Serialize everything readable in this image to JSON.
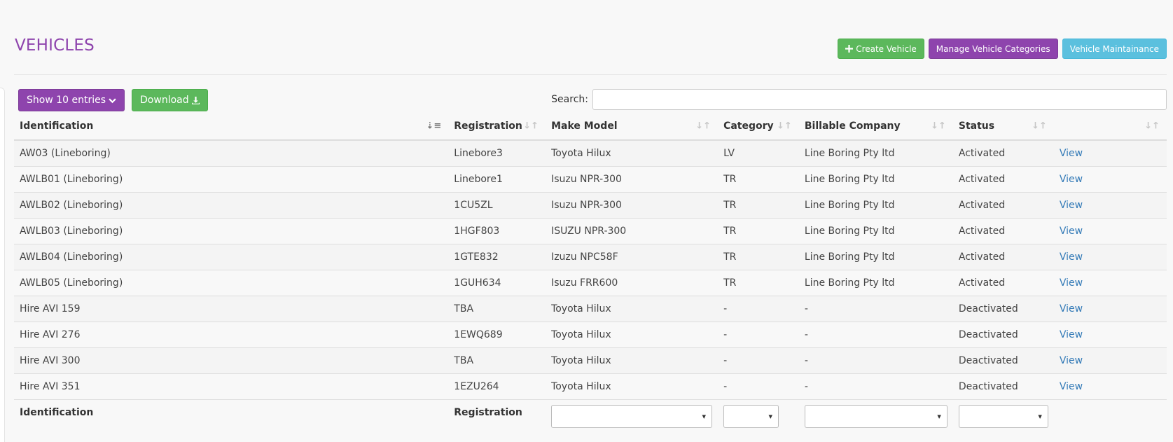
{
  "page": {
    "title": "VEHICLES"
  },
  "actions": {
    "create_label": "Create Vehicle",
    "manage_label": "Manage Vehicle Categories",
    "maintenance_label": "Vehicle Maintainance"
  },
  "toolbar": {
    "show_label": "Show 10 entries",
    "download_label": "Download",
    "search_label": "Search:",
    "search_value": ""
  },
  "table": {
    "headers": [
      "Identification",
      "Registration",
      "Make Model",
      "Category",
      "Billable Company",
      "Status",
      ""
    ],
    "rows": [
      [
        "AW03 (Lineboring)",
        "Linebore3",
        "Toyota Hilux",
        "LV",
        "Line Boring Pty ltd",
        "Activated",
        "View"
      ],
      [
        "AWLB01 (Lineboring)",
        "Linebore1",
        "Isuzu NPR-300",
        "TR",
        "Line Boring Pty ltd",
        "Activated",
        "View"
      ],
      [
        "AWLB02 (Lineboring)",
        "1CU5ZL",
        "Isuzu NPR-300",
        "TR",
        "Line Boring Pty ltd",
        "Activated",
        "View"
      ],
      [
        "AWLB03 (Lineboring)",
        "1HGF803",
        "ISUZU NPR-300",
        "TR",
        "Line Boring Pty ltd",
        "Activated",
        "View"
      ],
      [
        "AWLB04 (Lineboring)",
        "1GTE832",
        "Izuzu NPC58F",
        "TR",
        "Line Boring Pty ltd",
        "Activated",
        "View"
      ],
      [
        "AWLB05 (Lineboring)",
        "1GUH634",
        "Isuzu FRR600",
        "TR",
        "Line Boring Pty ltd",
        "Activated",
        "View"
      ],
      [
        "Hire AVI 159",
        "TBA",
        "Toyota Hilux",
        "-",
        "-",
        "Deactivated",
        "View"
      ],
      [
        "Hire AVI 276",
        "1EWQ689",
        "Toyota Hilux",
        "-",
        "-",
        "Deactivated",
        "View"
      ],
      [
        "Hire AVI 300",
        "TBA",
        "Toyota Hilux",
        "-",
        "-",
        "Deactivated",
        "View"
      ],
      [
        "Hire AVI 351",
        "1EZU264",
        "Toyota Hilux",
        "-",
        "-",
        "Deactivated",
        "View"
      ]
    ],
    "footer": {
      "identification": "Identification",
      "registration": "Registration"
    }
  },
  "colors": {
    "brand_purple": "#8e44ad",
    "green": "#5cb85c",
    "cyan": "#5bc0de",
    "link": "#337ab7"
  }
}
